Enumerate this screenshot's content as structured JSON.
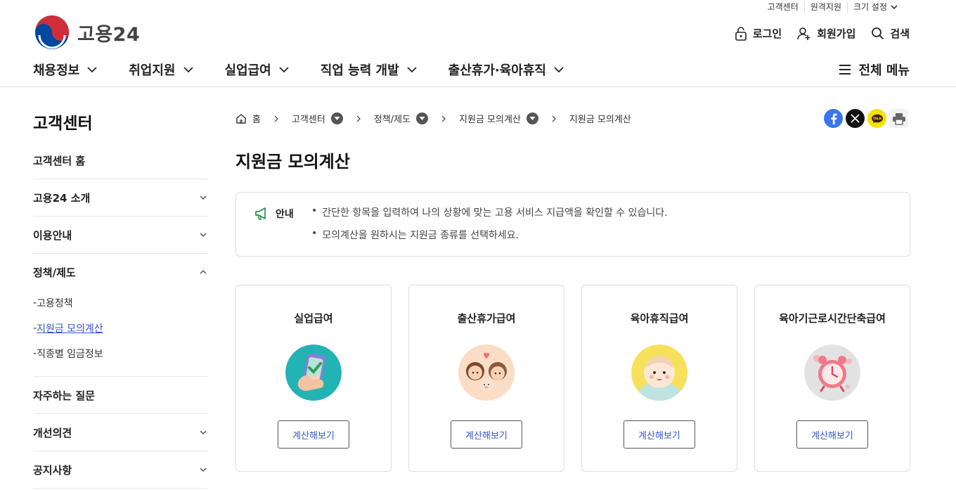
{
  "header": {
    "util_links": [
      "고객센터",
      "원격지원",
      "크기 설정"
    ],
    "logo_text": "고용24",
    "member": {
      "login": "로그인",
      "join": "회원가입",
      "search": "검색"
    },
    "gnb": [
      "채용정보",
      "취업지원",
      "실업급여",
      "직업 능력 개발",
      "출산휴가·육아휴직"
    ],
    "all_menu": "전체 메뉴"
  },
  "sidebar": {
    "title": "고객센터",
    "items": [
      {
        "label": "고객센터 홈"
      },
      {
        "label": "고용24 소개"
      },
      {
        "label": "이용안내"
      },
      {
        "label": "정책/제도"
      },
      {
        "label": "자주하는 질문"
      },
      {
        "label": "개선의견"
      },
      {
        "label": "공지사항"
      }
    ],
    "sub_items": [
      {
        "label": "고용정책"
      },
      {
        "label": "지원금 모의계산"
      },
      {
        "label": "직종별 임금정보"
      }
    ]
  },
  "breadcrumb": {
    "home": "홈",
    "items": [
      "고객센터",
      "정책/제도",
      "지원금 모의계산",
      "지원금 모의계산"
    ]
  },
  "page_title": "지원금 모의계산",
  "notice": {
    "label": "안내",
    "lines": [
      "간단한 항목을 입력하여 나의 상황에 맞는 고용 서비스 지급액을 확인할 수 있습니다.",
      "모의계산을 원하시는 지원금 종류를 선택하세요."
    ]
  },
  "cards": [
    {
      "title": "실업급여",
      "button": "계산해보기"
    },
    {
      "title": "출산휴가급여",
      "button": "계산해보기"
    },
    {
      "title": "육아휴직급여",
      "button": "계산해보기"
    },
    {
      "title": "육아기근로시간단축급여",
      "button": "계산해보기"
    }
  ],
  "colors": {
    "link_blue": "#3557c8",
    "facebook": "#3b74f1",
    "kakao": "#f7e100",
    "logo_red": "#cd2e3a",
    "logo_blue": "#0047a0"
  }
}
